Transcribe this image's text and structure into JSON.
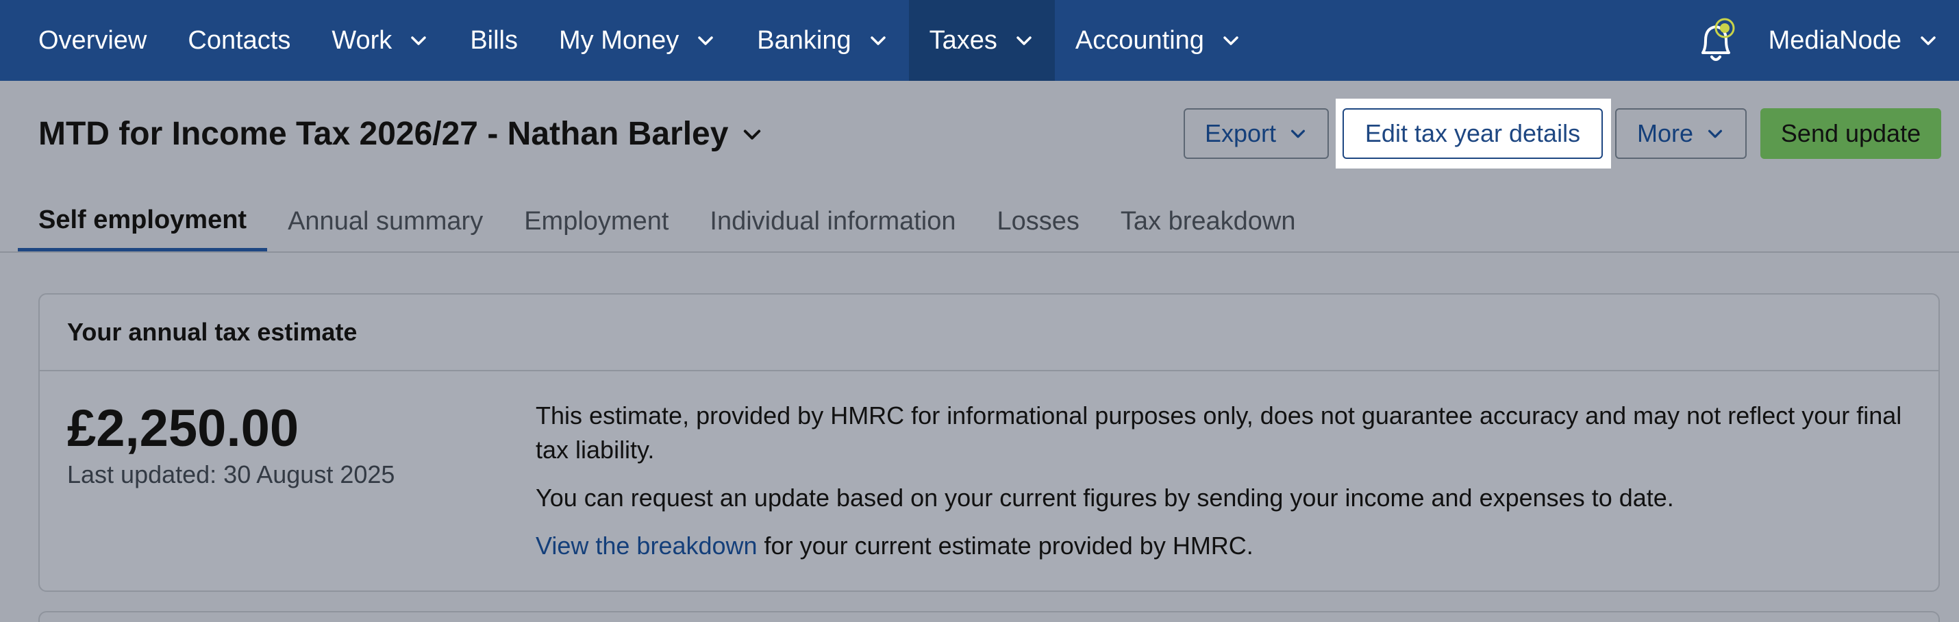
{
  "nav": {
    "items": [
      {
        "label": "Overview",
        "dropdown": false,
        "active": false
      },
      {
        "label": "Contacts",
        "dropdown": false,
        "active": false
      },
      {
        "label": "Work",
        "dropdown": true,
        "active": false
      },
      {
        "label": "Bills",
        "dropdown": false,
        "active": false
      },
      {
        "label": "My Money",
        "dropdown": true,
        "active": false
      },
      {
        "label": "Banking",
        "dropdown": true,
        "active": false
      },
      {
        "label": "Taxes",
        "dropdown": true,
        "active": true
      },
      {
        "label": "Accounting",
        "dropdown": true,
        "active": false
      }
    ],
    "account_label": "MediaNode",
    "bell_icon": "bell-icon",
    "notification_color": "#c9d34a",
    "bg_color": "#1e4782"
  },
  "header": {
    "title": "MTD for Income Tax 2026/27 - Nathan Barley",
    "buttons": {
      "export": "Export",
      "edit_tax_year": "Edit tax year details",
      "more": "More",
      "send_update": "Send update"
    },
    "send_color": "#5c9a4e"
  },
  "tabs": [
    {
      "label": "Self employment",
      "active": true
    },
    {
      "label": "Annual summary",
      "active": false
    },
    {
      "label": "Employment",
      "active": false
    },
    {
      "label": "Individual information",
      "active": false
    },
    {
      "label": "Losses",
      "active": false
    },
    {
      "label": "Tax breakdown",
      "active": false
    }
  ],
  "estimate_card": {
    "title": "Your annual tax estimate",
    "amount": "£2,250.00",
    "last_updated": "Last updated: 30 August 2025",
    "paragraph1": "This estimate, provided by HMRC for informational purposes only, does not guarantee accuracy and may not reflect your final tax liability.",
    "paragraph2": "You can request an update based on your current figures by sending your income and expenses to date.",
    "link_text": "View the breakdown",
    "paragraph3_rest": " for your current estimate provided by HMRC."
  }
}
